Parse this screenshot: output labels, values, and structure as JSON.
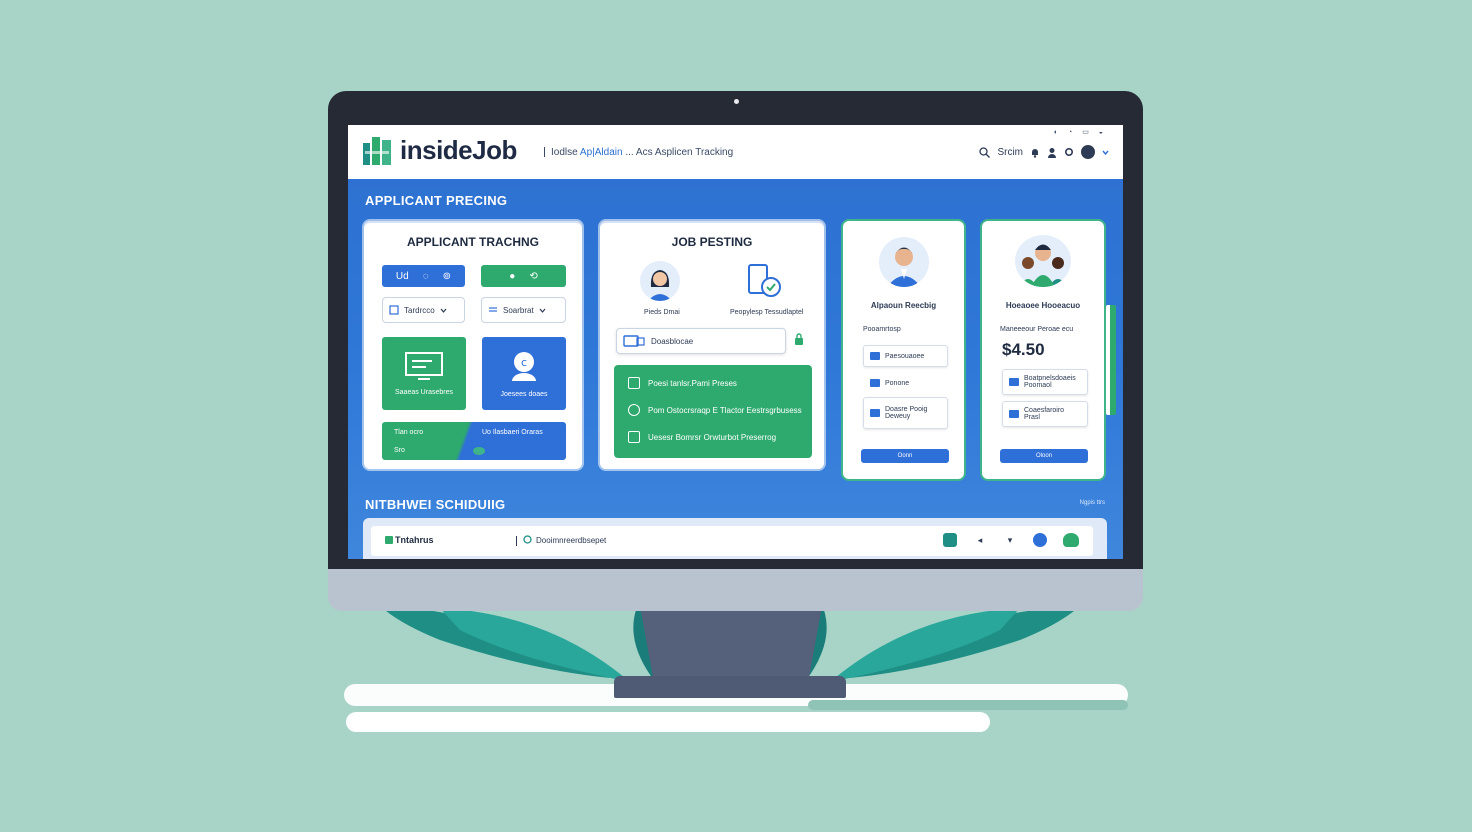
{
  "browser": {
    "tab_label": "Applicant Tracking",
    "window_controls": "– ▢ ×"
  },
  "header": {
    "logo_text": "insideJob",
    "breadcrumb_start": "Iodlse",
    "breadcrumb_accent": "Ap|Aldain",
    "breadcrumb_mid": "... Acs",
    "breadcrumb_end": "Asplicen Tracking",
    "search_label": "Srcim",
    "mini_icons": "◐ ◔ ▭ ◒"
  },
  "sections": {
    "top_title": "APPLICANT PRECING",
    "bottom_title": "NITBHWEI SCHIDUIIG",
    "view_all": "Ngpis  ttrs"
  },
  "applicant_card": {
    "title": "APPLICANT TRACHNG",
    "pill_blue": [
      "Ud",
      "◌",
      "⊚"
    ],
    "pill_green": [
      "●",
      "⟲"
    ],
    "select_left": "Tardrcco",
    "select_right": "Soarbrat",
    "tile_green_label": "Saaeas Urasebres",
    "tile_blue_label": "Joesees doaes",
    "split_left_top": "Tlan ocro",
    "split_left_bottom": "Sro",
    "split_right_top": "Uo Ilasbaeri Oraras"
  },
  "job_card": {
    "title": "JOB PESTING",
    "left_label": "Pieds Dmai",
    "right_label": "Peopylesp Tessudlaptel",
    "input_text": "Doasblocae",
    "rows": [
      "Poesi tanlsr.Pami Preses",
      "Pom Ostocrsraqp E Tlactor Eestrsgrbusess",
      "Uesesr Bomrsr Orwturbot Preserrog"
    ]
  },
  "profile_card": {
    "heading": "Alpaoun Reecbig",
    "subheading": "Pooamrtosp",
    "fields": [
      "Paesouaoee",
      "Ponone",
      "Doasre Pooig Deweuy"
    ],
    "button": "Oonn"
  },
  "pricing_card": {
    "heading": "Hoeaoee Hooeacuo",
    "subheading": "Maneeeour Peroae ecu",
    "price": "$4.50",
    "fields": [
      "Boatpnelsdoaeis Poomaol",
      "Coaesfaroiro Prasl"
    ],
    "button": "Oloon"
  },
  "schedule_bar": {
    "brand": "Tntahrus",
    "search": "Dooimnreerdbsepet"
  },
  "colors": {
    "blue": "#2f6fd8",
    "green": "#2eaa6e",
    "dark": "#1e2a40",
    "background": "#a8d4c8"
  }
}
